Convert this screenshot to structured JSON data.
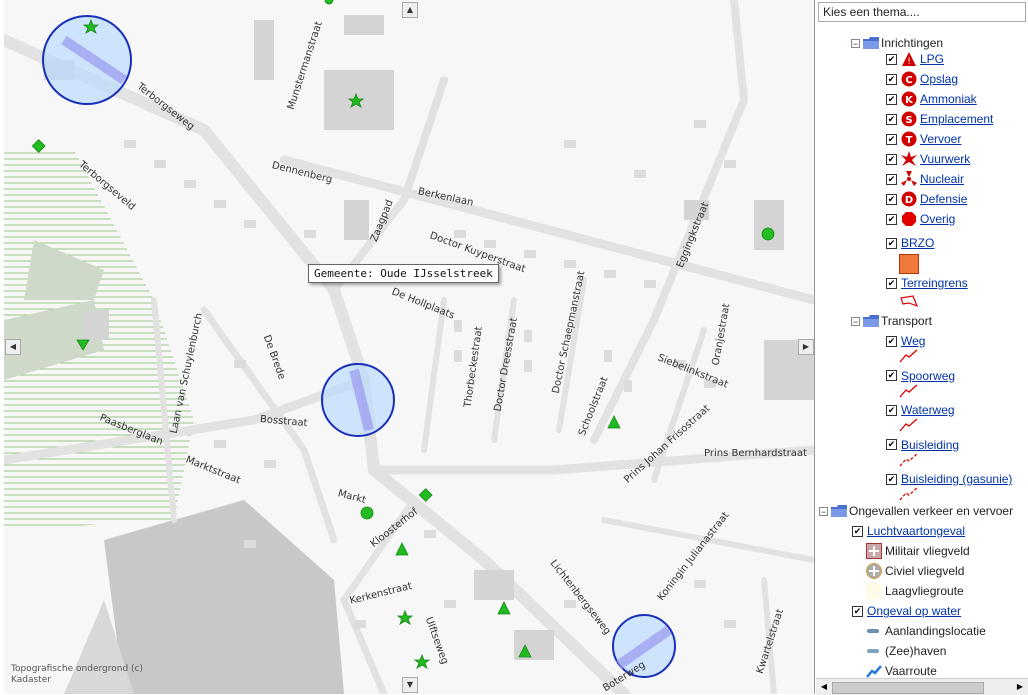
{
  "map": {
    "tooltip": "Gemeente: Oude IJsselstreek",
    "copyright": [
      "Topografische ondergrond (c)",
      "Kadaster"
    ],
    "streets": [
      {
        "name": "Munstermanstraat"
      },
      {
        "name": "Terborgseweg"
      },
      {
        "name": "Terborgseveld"
      },
      {
        "name": "Dennenberg"
      },
      {
        "name": "Berkenlaan"
      },
      {
        "name": "Zaagpad"
      },
      {
        "name": "Doctor Kuyperstraat"
      },
      {
        "name": "Eggingkstraat"
      },
      {
        "name": "De Hollplaats"
      },
      {
        "name": "De Brede"
      },
      {
        "name": "Laan van Schuylenburch"
      },
      {
        "name": "Thorbeckestraat"
      },
      {
        "name": "Doctor Dreesstraat"
      },
      {
        "name": "Doctor Schaepmanstraat"
      },
      {
        "name": "Oranjestraat"
      },
      {
        "name": "Siebelinkstraat"
      },
      {
        "name": "Paasberglaan"
      },
      {
        "name": "Bosstraat"
      },
      {
        "name": "Marktstraat"
      },
      {
        "name": "Schoolstraat"
      },
      {
        "name": "Prins Johan Frisostraat"
      },
      {
        "name": "Prins Bernhardstraat"
      },
      {
        "name": "Markt"
      },
      {
        "name": "Kloosterhof"
      },
      {
        "name": "Kerkenstraat"
      },
      {
        "name": "Ulftseweg"
      },
      {
        "name": "Lichtenbergseweg"
      },
      {
        "name": "Koningin Julianastraat"
      },
      {
        "name": "Kwartelstraat"
      },
      {
        "name": "Boterweg"
      }
    ]
  },
  "panel": {
    "theme_placeholder": "Kies een thema....",
    "inrichtingen": {
      "label": "Inrichtingen",
      "items": [
        {
          "label": "LPG",
          "letter": "",
          "color": "#d00000"
        },
        {
          "label": "Opslag",
          "letter": "C",
          "color": "#d00000"
        },
        {
          "label": "Ammoniak",
          "letter": "K",
          "color": "#d00000"
        },
        {
          "label": "Emplacement",
          "letter": "S",
          "color": "#d00000"
        },
        {
          "label": "Vervoer",
          "letter": "T",
          "color": "#d00000"
        },
        {
          "label": "Vuurwerk",
          "letter": "",
          "color": "#d00000"
        },
        {
          "label": "Nucleair",
          "letter": "",
          "color": "#d00000"
        },
        {
          "label": "Defensie",
          "letter": "D",
          "color": "#d00000"
        },
        {
          "label": "Overig",
          "letter": "",
          "color": "#e00000"
        }
      ],
      "brzo": "BRZO",
      "terreingrens": "Terreingrens"
    },
    "transport": {
      "label": "Transport",
      "items": [
        "Weg",
        "Spoorweg",
        "Waterweg",
        "Buisleiding",
        "Buisleiding (gasunie)"
      ]
    },
    "ongevallen": {
      "label": "Ongevallen verkeer en vervoer",
      "luchtvaart": "Luchtvaartongeval",
      "luchtvaart_sub": [
        "Militair vliegveld",
        "Civiel vliegveld",
        "Laagvliegroute"
      ],
      "water": "Ongeval op water",
      "water_sub": [
        "Aanlandingslocatie",
        "(Zee)haven",
        "Vaarroute"
      ]
    }
  }
}
